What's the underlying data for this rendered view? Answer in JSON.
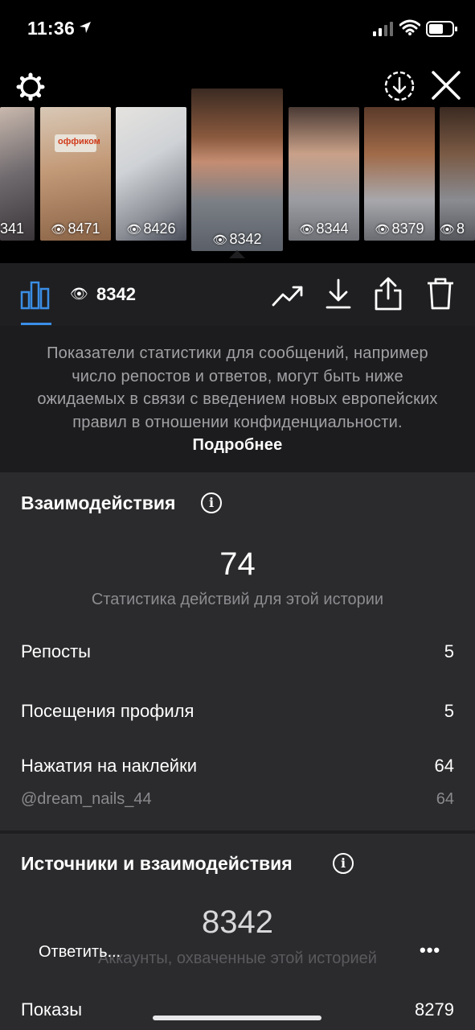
{
  "status_bar": {
    "time": "11:36"
  },
  "thumbnails": [
    {
      "views": "341"
    },
    {
      "views": "8471",
      "logo": "оффиком"
    },
    {
      "views": "8426"
    },
    {
      "views": "8342",
      "selected": true
    },
    {
      "views": "8344"
    },
    {
      "views": "8379"
    },
    {
      "views": "8"
    }
  ],
  "toolbar": {
    "views": "8342"
  },
  "notice": {
    "text": "Показатели статистики для сообщений, например число репостов и ответов, могут быть ниже ожидаемых в связи с введением новых европейских правил в отношении конфиденциальности.",
    "link": "Подробнее"
  },
  "interactions": {
    "title": "Взаимодействия",
    "total": "74",
    "subtitle": "Статистика действий для этой истории",
    "rows": [
      {
        "label": "Репосты",
        "value": "5"
      },
      {
        "label": "Посещения профиля",
        "value": "5"
      },
      {
        "label": "Нажатия на наклейки",
        "value": "64"
      },
      {
        "label": "@dream_nails_44",
        "value": "64"
      }
    ]
  },
  "sources": {
    "title": "Источники и взаимодействия",
    "total": "8342",
    "subtitle": "Аккаунты, охваченные этой историей",
    "rows": [
      {
        "label": "Показы",
        "value": "8279"
      }
    ]
  },
  "reply_bar": {
    "placeholder": "Ответить...",
    "more": "•••"
  },
  "colors": {
    "accent": "#3a8ee6",
    "background": "#000000",
    "panel": "#2b2b2d"
  }
}
